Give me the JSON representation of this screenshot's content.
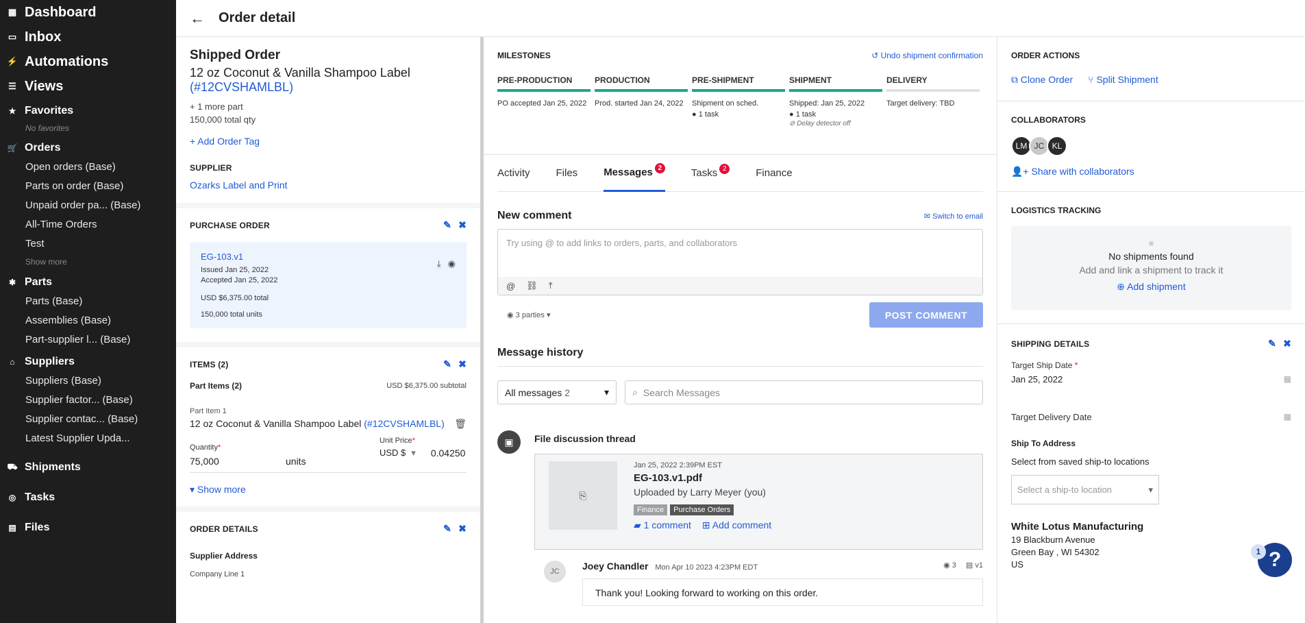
{
  "sidebar": {
    "top": [
      {
        "label": "Dashboard",
        "icon": "dashboard-icon"
      },
      {
        "label": "Inbox",
        "icon": "inbox-icon"
      },
      {
        "label": "Automations",
        "icon": "bolt-icon"
      },
      {
        "label": "Views",
        "icon": "list-icon"
      }
    ],
    "favorites": {
      "label": "Favorites",
      "empty": "No favorites"
    },
    "orders": {
      "label": "Orders",
      "items": [
        "Open orders (Base)",
        "Parts on order (Base)",
        "Unpaid order pa... (Base)",
        "All-Time Orders",
        "Test"
      ],
      "more": "Show more"
    },
    "parts": {
      "label": "Parts",
      "items": [
        "Parts (Base)",
        "Assemblies (Base)",
        "Part-supplier l... (Base)"
      ]
    },
    "suppliers": {
      "label": "Suppliers",
      "items": [
        "Suppliers (Base)",
        "Supplier factor... (Base)",
        "Supplier contac... (Base)",
        "Latest Supplier Upda..."
      ]
    },
    "shipments": "Shipments",
    "tasks": "Tasks",
    "files": "Files"
  },
  "header": {
    "title": "Order detail"
  },
  "left": {
    "status": "Shipped Order",
    "product": "12 oz Coconut & Vanilla Shampoo Label",
    "product_code": "(#12CVSHAMLBL)",
    "more_part": "+ 1 more part",
    "total_qty": "150,000 total qty",
    "add_tag": "+ Add Order Tag",
    "supplier_label": "SUPPLIER",
    "supplier": "Ozarks Label and Print",
    "po": {
      "label": "PURCHASE ORDER",
      "id": "EG-103.v1",
      "issued": "Issued Jan 25, 2022",
      "accepted": "Accepted Jan 25, 2022",
      "total": "USD $6,375.00 total",
      "units": "150,000 total units"
    },
    "items": {
      "label": "ITEMS (2)",
      "part_items": "Part Items (2)",
      "subtotal": "USD $6,375.00 subtotal",
      "item_label": "Part Item 1",
      "item_name": "12 oz Coconut & Vanilla Shampoo Label",
      "item_code": "(#12CVSHAMLBL)",
      "qty_label": "Quantity",
      "qty": "75,000",
      "units": "units",
      "price_label": "Unit Price",
      "currency": "USD $",
      "price": "0.04250",
      "show_more": "Show more"
    },
    "order_details": {
      "label": "ORDER DETAILS",
      "supplier_address": "Supplier Address",
      "line1": "Company Line 1"
    }
  },
  "milestones": {
    "label": "MILESTONES",
    "undo": "Undo shipment confirmation",
    "stages": [
      {
        "name": "PRE-PRODUCTION",
        "text": "PO accepted Jan 25, 2022",
        "done": true
      },
      {
        "name": "PRODUCTION",
        "text": "Prod. started Jan 24, 2022",
        "done": true
      },
      {
        "name": "PRE-SHIPMENT",
        "text": "Shipment on sched.",
        "task": "1 task",
        "done": true
      },
      {
        "name": "SHIPMENT",
        "text": "Shipped: Jan 25, 2022",
        "task": "1 task",
        "note": "Delay detector off",
        "done": true
      },
      {
        "name": "DELIVERY",
        "text": "Target delivery: TBD",
        "done": false
      }
    ]
  },
  "tabs": [
    {
      "label": "Activity"
    },
    {
      "label": "Files"
    },
    {
      "label": "Messages",
      "badge": "2"
    },
    {
      "label": "Tasks",
      "badge": "2"
    },
    {
      "label": "Finance"
    }
  ],
  "comment": {
    "title": "New comment",
    "switch": "Switch to email",
    "placeholder": "Try using @ to add links to orders, parts, and collaborators",
    "parties": "3 parties",
    "post": "POST COMMENT"
  },
  "history": {
    "title": "Message history",
    "filter": "All messages",
    "filter_count": "2",
    "search_placeholder": "Search Messages",
    "thread_title": "File discussion thread",
    "file": {
      "date": "Jan 25, 2022 2:39PM EST",
      "name": "EG-103.v1.pdf",
      "by": "Uploaded by Larry Meyer (you)",
      "tags": [
        "Finance",
        "Purchase Orders"
      ],
      "comments": "1 comment",
      "add": "Add comment"
    },
    "message": {
      "initials": "JC",
      "author": "Joey Chandler",
      "time": "Mon Apr 10 2023 4:23PM EDT",
      "views": "3",
      "version": "v1",
      "text": "Thank you! Looking forward to working on this order."
    }
  },
  "right": {
    "actions_label": "ORDER ACTIONS",
    "clone": "Clone Order",
    "split": "Split Shipment",
    "collab_label": "COLLABORATORS",
    "collaborators": [
      {
        "initials": "LM",
        "color": "#2b2b2b"
      },
      {
        "initials": "JC",
        "color": "#c9c9c9"
      },
      {
        "initials": "KL",
        "color": "#2b2b2b"
      }
    ],
    "share": "Share with collaborators",
    "logistics_label": "LOGISTICS TRACKING",
    "no_ship": "No shipments found",
    "no_ship_sub": "Add and link a shipment to track it",
    "add_ship": "Add shipment",
    "shipping_label": "SHIPPING DETAILS",
    "target_ship_label": "Target Ship Date",
    "target_ship": "Jan 25, 2022",
    "target_delivery_label": "Target Delivery Date",
    "ship_to_label": "Ship To Address",
    "ship_to_sub": "Select from saved ship-to locations",
    "ship_to_ph": "Select a ship-to location",
    "address_name": "White Lotus Manufacturing",
    "address_line1": "19 Blackburn Avenue",
    "address_line2": "Green Bay , WI 54302",
    "address_line3": "US"
  },
  "help": {
    "badge": "1",
    "label": "?"
  }
}
